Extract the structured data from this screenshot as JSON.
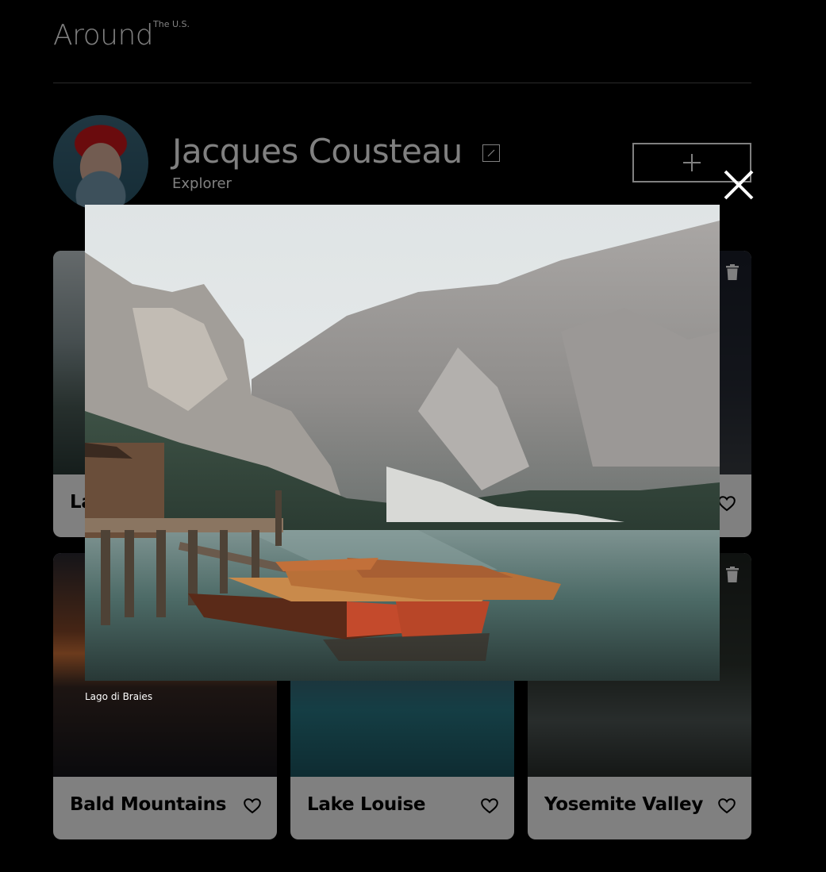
{
  "header": {
    "logo": "Around",
    "logo_sup": "The U.S."
  },
  "profile": {
    "name": "Jacques Cousteau",
    "job": "Explorer"
  },
  "cards": [
    {
      "title": "La"
    },
    {
      "title": ""
    },
    {
      "title": ""
    },
    {
      "title": "Bald Mountains"
    },
    {
      "title": "Lake Louise"
    },
    {
      "title": "Yosemite Valley"
    }
  ],
  "popup": {
    "caption": "Lago di Braies"
  },
  "colors": {
    "background": "#000000",
    "card": "#ffffff",
    "overlay_text": "#ffffff"
  },
  "icons": [
    "edit-icon",
    "plus-icon",
    "close-icon",
    "trash-icon",
    "heart-icon"
  ]
}
